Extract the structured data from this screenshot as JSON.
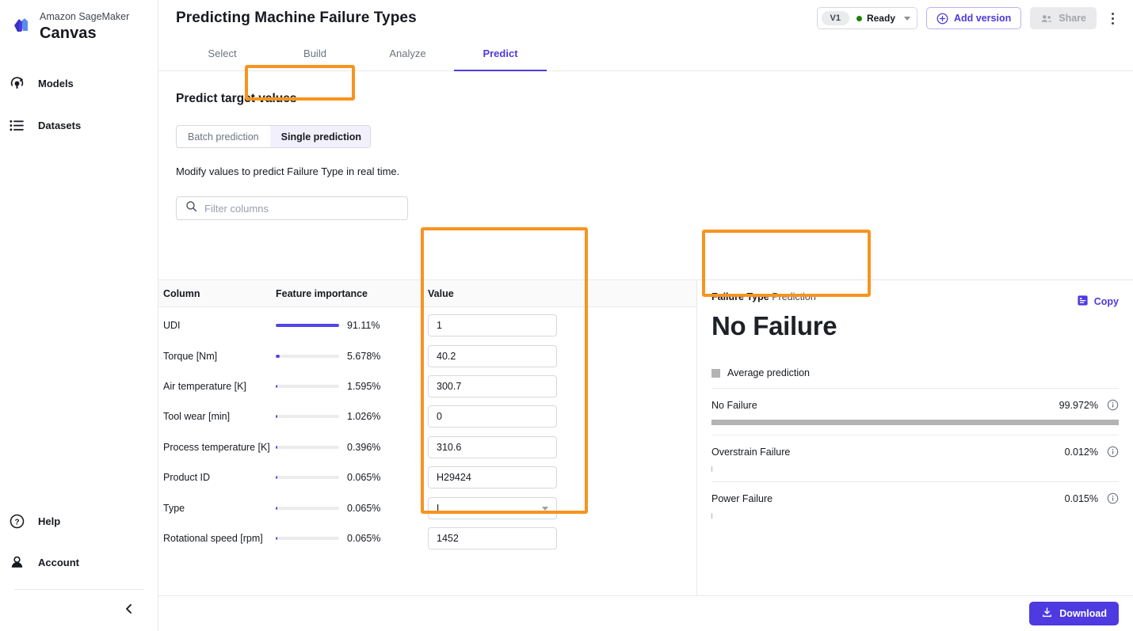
{
  "sidebar": {
    "brand_line1": "Amazon SageMaker",
    "brand_line2": "Canvas",
    "items": [
      {
        "label": "Models",
        "icon": "models-icon"
      },
      {
        "label": "Datasets",
        "icon": "datasets-icon"
      }
    ],
    "bottom_items": [
      {
        "label": "Help",
        "icon": "help-icon"
      },
      {
        "label": "Account",
        "icon": "account-icon"
      }
    ],
    "collapse_icon": "chevron-left-icon"
  },
  "header": {
    "title": "Predicting Machine Failure Types",
    "version_pill": "V1",
    "version_status": "Ready",
    "status_color": "#1d8102",
    "add_version_label": "Add version",
    "share_label": "Share",
    "more_icon": "kebab-menu-icon"
  },
  "tabs": [
    {
      "label": "Select",
      "active": false
    },
    {
      "label": "Build",
      "active": false
    },
    {
      "label": "Analyze",
      "active": false
    },
    {
      "label": "Predict",
      "active": true
    }
  ],
  "main": {
    "section_title": "Predict target values",
    "mode_tabs": [
      {
        "label": "Batch prediction",
        "active": false
      },
      {
        "label": "Single prediction",
        "active": true
      }
    ],
    "description": "Modify values to predict Failure Type in real time.",
    "filter_placeholder": "Filter columns",
    "filter_value": ""
  },
  "table": {
    "headers": [
      "Column",
      "Feature importance",
      "Value"
    ],
    "rows": [
      {
        "column": "UDI",
        "importance_pct": "91.11%",
        "importance_value": 91.11,
        "value": "1",
        "type": "text"
      },
      {
        "column": "Torque [Nm]",
        "importance_pct": "5.678%",
        "importance_value": 5.678,
        "value": "40.2",
        "type": "text"
      },
      {
        "column": "Air temperature [K]",
        "importance_pct": "1.595%",
        "importance_value": 1.595,
        "value": "300.7",
        "type": "text"
      },
      {
        "column": "Tool wear [min]",
        "importance_pct": "1.026%",
        "importance_value": 1.026,
        "value": "0",
        "type": "text"
      },
      {
        "column": "Process temperature [K]",
        "importance_pct": "0.396%",
        "importance_value": 0.396,
        "value": "310.6",
        "type": "text"
      },
      {
        "column": "Product ID",
        "importance_pct": "0.065%",
        "importance_value": 0.065,
        "value": "H29424",
        "type": "text"
      },
      {
        "column": "Type",
        "importance_pct": "0.065%",
        "importance_value": 0.065,
        "value": "L",
        "type": "select"
      },
      {
        "column": "Rotational speed [rpm]",
        "importance_pct": "0.065%",
        "importance_value": 0.065,
        "value": "1452",
        "type": "text"
      }
    ]
  },
  "prediction": {
    "label_bold": "Failure Type",
    "label_rest": " Prediction",
    "value": "No Failure",
    "copy_label": "Copy",
    "legend_label": "Average prediction",
    "legend_color": "#b3b3b3",
    "probabilities": [
      {
        "name": "No Failure",
        "pct": "99.972%",
        "value": 99.972
      },
      {
        "name": "Overstrain Failure",
        "pct": "0.012%",
        "value": 0.012
      },
      {
        "name": "Power Failure",
        "pct": "0.015%",
        "value": 0.015
      }
    ]
  },
  "footer": {
    "download_label": "Download"
  },
  "colors": {
    "accent": "#4d3ae0",
    "bar": "#5344e8",
    "highlight": "#f7941e",
    "status_ready": "#1d8102"
  }
}
